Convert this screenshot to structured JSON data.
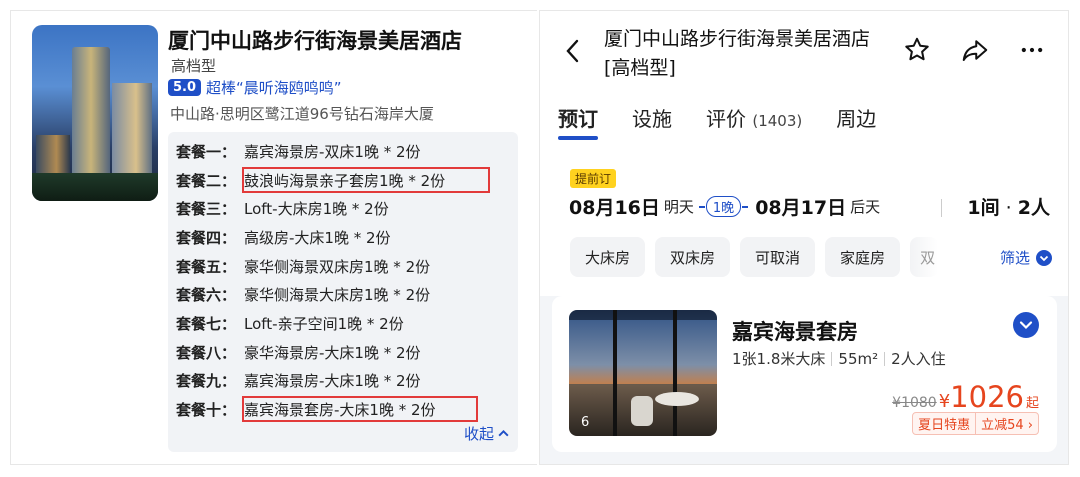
{
  "hotel": {
    "name": "厦门中山路步行街海景美居酒店",
    "grade": "高档型",
    "score": "5.0",
    "score_label": "超棒“晨听海鸥鸣鸣”",
    "address": "中山路·思明区鹭江道96号钻石海岸大厦"
  },
  "packages": [
    {
      "label": "套餐一：",
      "text": "嘉宾海景房-双床1晚 * 2份",
      "highlight": false
    },
    {
      "label": "套餐二：",
      "text": "鼓浪屿海景亲子套房1晚 * 2份",
      "highlight": true
    },
    {
      "label": "套餐三：",
      "text": "Loft-大床房1晚 * 2份",
      "highlight": false
    },
    {
      "label": "套餐四：",
      "text": "高级房-大床1晚 * 2份",
      "highlight": false
    },
    {
      "label": "套餐五：",
      "text": "豪华侧海景双床房1晚 * 2份",
      "highlight": false
    },
    {
      "label": "套餐六：",
      "text": "豪华侧海景大床房1晚 * 2份",
      "highlight": false
    },
    {
      "label": "套餐七：",
      "text": "Loft-亲子空间1晚 * 2份",
      "highlight": false
    },
    {
      "label": "套餐八：",
      "text": "豪华海景房-大床1晚 * 2份",
      "highlight": false
    },
    {
      "label": "套餐九：",
      "text": "嘉宾海景房-大床1晚 * 2份",
      "highlight": false
    },
    {
      "label": "套餐十：",
      "text": "嘉宾海景套房-大床1晚 * 2份",
      "highlight": true
    }
  ],
  "collapse_label": "收起",
  "detail": {
    "title": "厦门中山路步行街海景美居酒店[高档型]",
    "tabs": [
      {
        "label": "预订",
        "count": "",
        "active": true
      },
      {
        "label": "设施",
        "count": "",
        "active": false
      },
      {
        "label": "评价",
        "count": "(1403)",
        "active": false
      },
      {
        "label": "周边",
        "count": "",
        "active": false
      }
    ],
    "advance_tag": "提前订",
    "checkin_date": "08月16日",
    "checkin_day": "明天",
    "nights": "1晚",
    "checkout_date": "08月17日",
    "checkout_day": "后天",
    "rooms": "1间",
    "guests": "2人",
    "chips": [
      "大床房",
      "双床房",
      "可取消",
      "家庭房",
      "双"
    ],
    "filter_label": "筛选",
    "room": {
      "name": "嘉宾海景套房",
      "bed": "1张1.8米大床",
      "area": "55m²",
      "occupancy": "2人入住",
      "photo_count": "6",
      "old_price": "¥1080",
      "currency": "¥",
      "price": "1026",
      "price_suffix": "起",
      "promo_tag": "夏日特惠",
      "promo_discount": "立减54 ›"
    }
  },
  "colors": {
    "accent": "#1f4fc7",
    "price": "#e6451e",
    "highlight_box": "#e23a3a",
    "advance_tag": "#ffd21f"
  },
  "icons": [
    "back-arrow-icon",
    "star-icon",
    "share-icon",
    "more-icon",
    "chevron-up-icon",
    "chevron-down-icon"
  ]
}
